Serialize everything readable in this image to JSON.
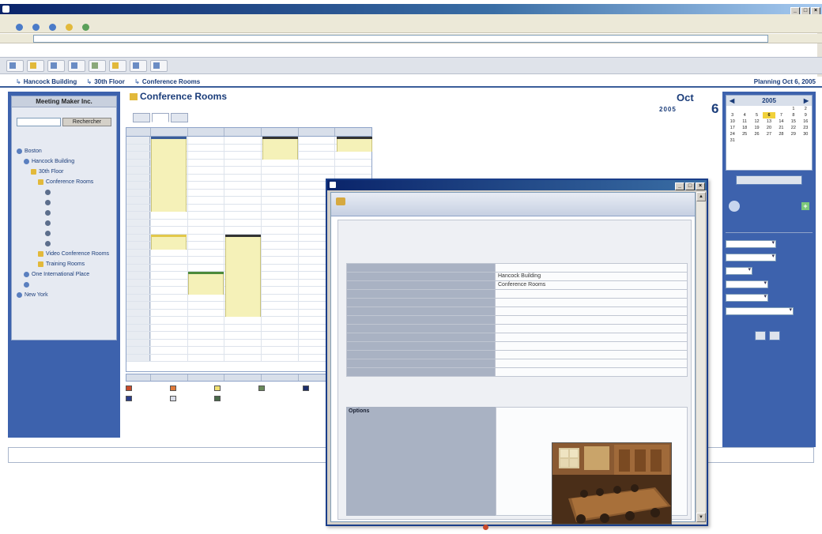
{
  "browser": {
    "title": "",
    "menu": [
      "",
      "",
      "",
      "",
      "",
      ""
    ],
    "toolbar": [
      "",
      "",
      "",
      "",
      ""
    ],
    "address_label": "",
    "address": "",
    "go": "",
    "links": "",
    "window_buttons": [
      "_",
      "□",
      "×"
    ]
  },
  "app_toolbar": {
    "buttons": [
      "",
      "",
      "",
      "",
      "",
      "",
      "",
      ""
    ]
  },
  "breadcrumb": {
    "items": [
      "Hancock Building",
      "30th Floor",
      "Conference Rooms"
    ],
    "planning_title": "Planning Oct 6, 2005"
  },
  "sidebar": {
    "heading": "Meeting Maker Inc.",
    "lines": [
      "",
      "",
      ""
    ],
    "search_button": "Rechercher",
    "tree": [
      {
        "label": "Boston",
        "indent": 0,
        "icon": "globe"
      },
      {
        "label": "Hancock Building",
        "indent": 1,
        "icon": "building"
      },
      {
        "label": "30th Floor",
        "indent": 2,
        "icon": "folder"
      },
      {
        "label": "Conference Rooms",
        "indent": 3,
        "icon": "folder"
      },
      {
        "label": "",
        "indent": 4,
        "icon": "room"
      },
      {
        "label": "",
        "indent": 4,
        "icon": "room"
      },
      {
        "label": "",
        "indent": 4,
        "icon": "room"
      },
      {
        "label": "",
        "indent": 4,
        "icon": "room"
      },
      {
        "label": "",
        "indent": 4,
        "icon": "room"
      },
      {
        "label": "",
        "indent": 4,
        "icon": "room"
      },
      {
        "label": "Video Conference Rooms",
        "indent": 3,
        "icon": "folder"
      },
      {
        "label": "Training Rooms",
        "indent": 3,
        "icon": "folder"
      },
      {
        "label": "One International Place",
        "indent": 1,
        "icon": "building"
      },
      {
        "label": "",
        "indent": 1,
        "icon": "building"
      },
      {
        "label": "New York",
        "indent": 0,
        "icon": "globe"
      }
    ]
  },
  "main": {
    "title": "Conference Rooms",
    "subtitle": "",
    "tabs": [
      "",
      "",
      ""
    ],
    "date": {
      "month": "Oct",
      "year": "2005",
      "day": "6",
      "week": ""
    },
    "columns": [
      "",
      "",
      "",
      "",
      "",
      ""
    ],
    "times": [
      "",
      "",
      "",
      "",
      "",
      "",
      "",
      "",
      "",
      "",
      "",
      "",
      "",
      "",
      "",
      "",
      "",
      "",
      "",
      "",
      "",
      "",
      "",
      "",
      "",
      "",
      "",
      "",
      "",
      ""
    ],
    "events": [
      {
        "label": "",
        "color": "#3a5d9a"
      },
      {
        "label": "",
        "color": "#333333"
      },
      {
        "label": "",
        "color": "#333333"
      },
      {
        "label": "",
        "color": "#e2c84a"
      },
      {
        "label": "",
        "color": "#333333"
      },
      {
        "label": "",
        "color": "#4c8a3a"
      }
    ],
    "legend": [
      {
        "label": "",
        "color": "#c94a2a"
      },
      {
        "label": "",
        "color": "#e07a3a"
      },
      {
        "label": "",
        "color": "#f1e070"
      },
      {
        "label": "",
        "color": "#6a8a5a"
      },
      {
        "label": "",
        "color": "#1b2d6a"
      },
      {
        "label": "",
        "color": "#2a3d8a"
      },
      {
        "label": "",
        "color": "#d8dce8"
      },
      {
        "label": "",
        "color": "#4a6a4a"
      }
    ]
  },
  "right_panel": {
    "mini_calendar": {
      "year": "2005",
      "months": [
        "",
        "",
        "",
        "",
        "",
        "",
        "",
        "",
        "",
        "",
        "",
        ""
      ],
      "day_headers": [
        "",
        "",
        "",
        "",
        "",
        "",
        ""
      ],
      "days": [
        "",
        "",
        "",
        "",
        "",
        "1",
        "2",
        "3",
        "4",
        "5",
        "6",
        "7",
        "8",
        "9",
        "10",
        "11",
        "12",
        "13",
        "14",
        "15",
        "16",
        "17",
        "18",
        "19",
        "20",
        "21",
        "22",
        "23",
        "24",
        "25",
        "26",
        "27",
        "28",
        "29",
        "30",
        "31",
        "",
        "",
        "",
        "",
        "",
        ""
      ],
      "today": "6"
    },
    "today_button": "",
    "reservation_box": "",
    "quick_title": "",
    "fields": [
      {
        "label": "",
        "value": ""
      },
      {
        "label": "",
        "value": ""
      },
      {
        "label": "",
        "value": ""
      },
      {
        "label": "",
        "value": ""
      },
      {
        "label": "",
        "value": ""
      }
    ],
    "subject_label": "",
    "subject_value": "",
    "buttons": [
      "",
      ""
    ]
  },
  "status": {
    "text": ""
  },
  "popup": {
    "title": "",
    "header": [
      "",
      ""
    ],
    "room_name": "",
    "properties": [
      {
        "key": "",
        "value": ""
      },
      {
        "key": "",
        "value": "Hancock Building"
      },
      {
        "key": "",
        "value": "Conference Rooms"
      },
      {
        "key": "",
        "value": ""
      },
      {
        "key": "",
        "value": ""
      },
      {
        "key": "",
        "value": ""
      },
      {
        "key": "",
        "value": ""
      },
      {
        "key": "",
        "value": ""
      },
      {
        "key": "",
        "value": ""
      },
      {
        "key": "",
        "value": ""
      },
      {
        "key": "",
        "value": ""
      },
      {
        "key": "",
        "value": ""
      },
      {
        "key": "",
        "value": ""
      },
      {
        "key": "Options",
        "value": ""
      }
    ],
    "options": [
      {
        "key": "",
        "value": "",
        "link": false
      },
      {
        "key": "",
        "value": "",
        "link": false
      },
      {
        "key": "",
        "value": "",
        "link": false
      },
      {
        "key": "",
        "value": "",
        "link": false
      },
      {
        "key": "",
        "value": "",
        "link": true
      },
      {
        "key": "",
        "value": "",
        "link": true
      },
      {
        "key": "",
        "value": "",
        "link": true
      }
    ],
    "projection_note": "",
    "close_link": ""
  }
}
